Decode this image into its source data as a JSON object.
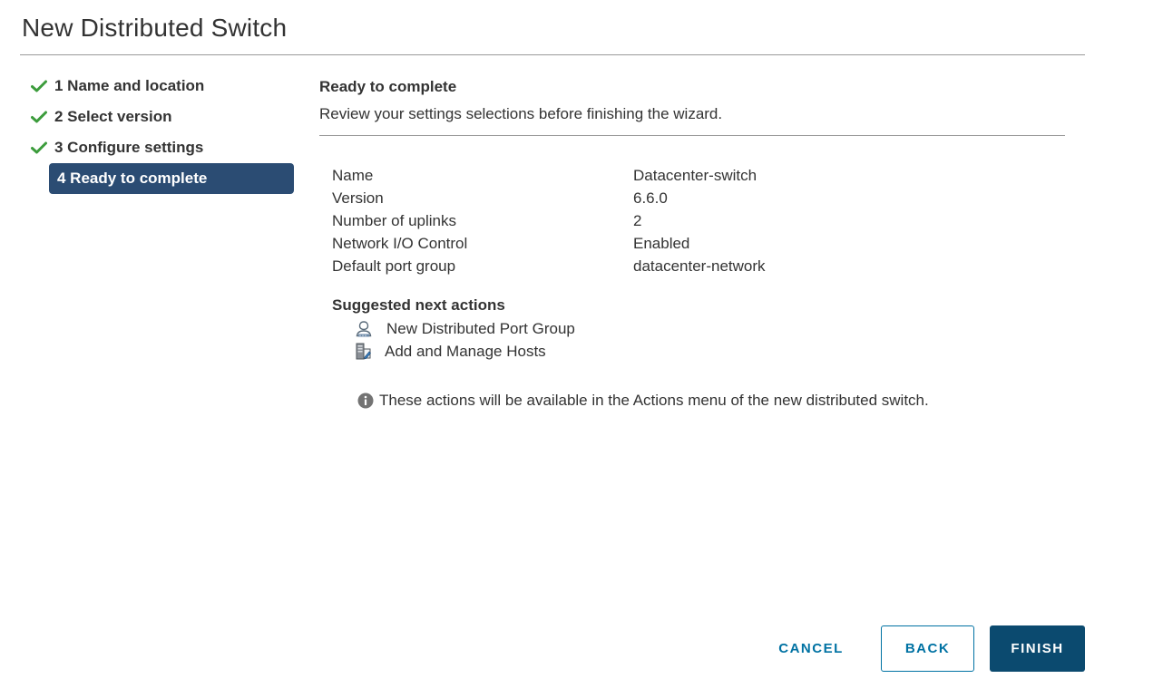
{
  "dialog": {
    "title": "New Distributed Switch"
  },
  "steps": [
    {
      "label": "1 Name and location",
      "completed": true
    },
    {
      "label": "2 Select version",
      "completed": true
    },
    {
      "label": "3 Configure settings",
      "completed": true
    },
    {
      "label": "4 Ready to complete",
      "active": true
    }
  ],
  "main": {
    "title": "Ready to complete",
    "description": "Review your settings selections before finishing the wizard.",
    "settings": [
      {
        "key": "Name",
        "value": "Datacenter-switch"
      },
      {
        "key": "Version",
        "value": "6.6.0"
      },
      {
        "key": "Number of uplinks",
        "value": "2"
      },
      {
        "key": "Network I/O Control",
        "value": "Enabled"
      },
      {
        "key": "Default port group",
        "value": "datacenter-network"
      }
    ],
    "next_actions_title": "Suggested next actions",
    "next_actions": [
      {
        "label": "New Distributed Port Group",
        "icon": "port-group-icon"
      },
      {
        "label": "Add and Manage Hosts",
        "icon": "manage-hosts-icon"
      }
    ],
    "info_text": "These actions will be available in the Actions menu of the new distributed switch.",
    "info_icon": "info-icon"
  },
  "footer": {
    "cancel_label": "CANCEL",
    "back_label": "BACK",
    "finish_label": "FINISH"
  },
  "colors": {
    "active_step_bg": "#2b4c73",
    "check_green": "#3c9c3c",
    "primary_button": "#0b4a6f",
    "link_blue": "#0072a3"
  }
}
